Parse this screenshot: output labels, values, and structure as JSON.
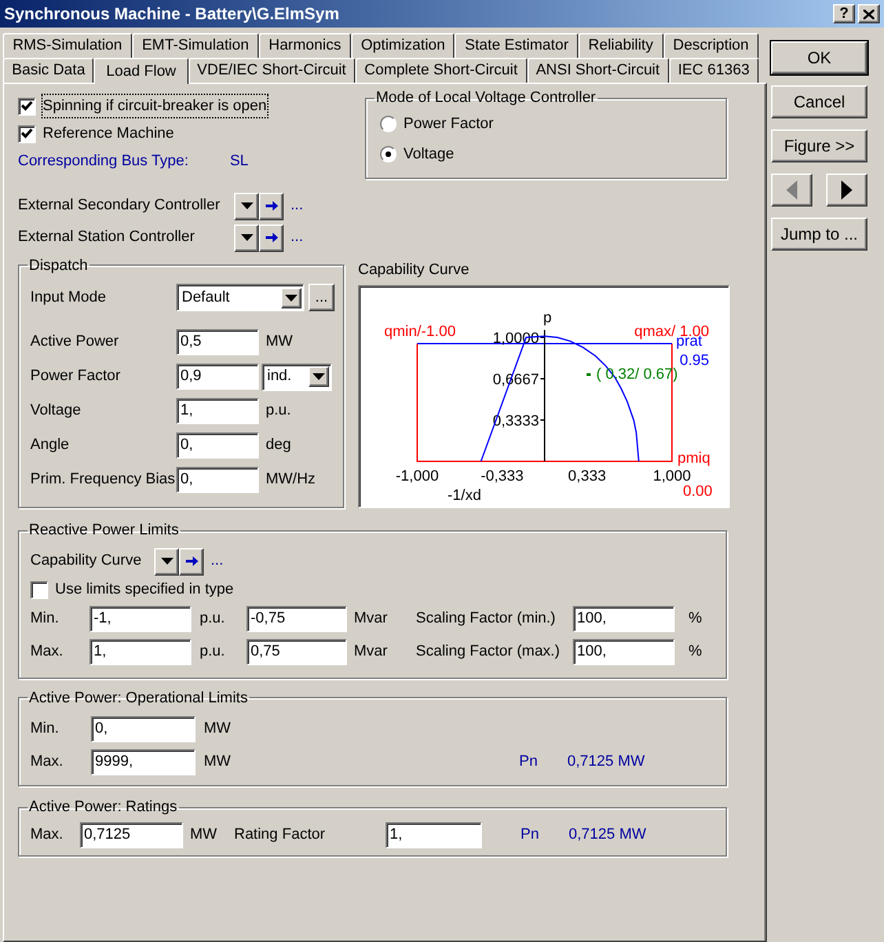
{
  "window": {
    "title": "Synchronous Machine - Battery\\G.ElmSym",
    "help": "?"
  },
  "tab_rows": [
    {
      "tabs": [
        {
          "label": "RMS-Simulation",
          "selected": false
        },
        {
          "label": "EMT-Simulation",
          "selected": false
        },
        {
          "label": "Harmonics",
          "selected": false
        },
        {
          "label": "Optimization",
          "selected": false
        },
        {
          "label": "State Estimator",
          "selected": false
        },
        {
          "label": "Reliability",
          "selected": false
        },
        {
          "label": "Description",
          "selected": false
        }
      ]
    },
    {
      "tabs": [
        {
          "label": "Basic Data",
          "selected": false
        },
        {
          "label": "Load Flow",
          "selected": true
        },
        {
          "label": "VDE/IEC Short-Circuit",
          "selected": false
        },
        {
          "label": "Complete Short-Circuit",
          "selected": false
        },
        {
          "label": "ANSI Short-Circuit",
          "selected": false
        },
        {
          "label": "IEC 61363",
          "selected": false
        }
      ]
    }
  ],
  "options": [
    {
      "label": "Spinning if circuit-breaker is open",
      "checked": true
    },
    {
      "label": "Reference Machine",
      "checked": true
    }
  ],
  "bus_type": {
    "label": "Corresponding Bus Type:",
    "value": "SL"
  },
  "voltage_mode": {
    "title": "Mode of Local Voltage Controller",
    "options": [
      {
        "label": "Power Factor",
        "selected": false
      },
      {
        "label": "Voltage",
        "selected": true
      }
    ]
  },
  "external_controllers": [
    {
      "label": "External Secondary Controller",
      "more": "..."
    },
    {
      "label": "External Station Controller",
      "more": "..."
    }
  ],
  "dispatch": {
    "title": "Dispatch",
    "input_mode": {
      "label": "Input Mode",
      "value": "Default",
      "more": "..."
    },
    "fields": [
      {
        "label": "Active Power",
        "value": "0,5",
        "kind": "unit",
        "unit": "MW"
      },
      {
        "label": "Power Factor",
        "value": "0,9",
        "kind": "select",
        "option": "ind."
      },
      {
        "label": "Voltage",
        "value": "1,",
        "kind": "unit",
        "unit": "p.u."
      },
      {
        "label": "Angle",
        "value": "0,",
        "kind": "unit",
        "unit": "deg"
      },
      {
        "label": "Prim. Frequency Bias",
        "value": "0,",
        "kind": "unit",
        "unit": "MW/Hz"
      }
    ]
  },
  "capability_curve": {
    "title": "Capability Curve",
    "chart_data": {
      "type": "line",
      "xlabel": "-1/xd",
      "ylabel": "p",
      "xlim": [
        -1,
        1
      ],
      "ylim": [
        0,
        1.06
      ],
      "xticks": [
        {
          "value": -1,
          "label": "-1,000"
        },
        {
          "value": -0.333,
          "label": "-0,333"
        },
        {
          "value": 0.333,
          "label": "0,333"
        },
        {
          "value": 1,
          "label": "1,000"
        }
      ],
      "yticks": [
        {
          "value": 0.3333,
          "label": "0,3333"
        },
        {
          "value": 0.6667,
          "label": "0,6667"
        },
        {
          "value": 1,
          "label": "1,0000"
        }
      ],
      "x": [
        -0.5,
        -0.145,
        0,
        0.1,
        0.2,
        0.3,
        0.4,
        0.48,
        0.55,
        0.6,
        0.65,
        0.7,
        0.72,
        0.74
      ],
      "series": [
        {
          "color": "#0000ff",
          "values": [
            0,
            1.0,
            1.01,
            1.0,
            0.97,
            0.92,
            0.85,
            0.77,
            0.68,
            0.59,
            0.48,
            0.33,
            0.23,
            0
          ]
        }
      ],
      "ref_lines": [
        {
          "axis": "y",
          "value": 0.95,
          "color": "#0000ff"
        }
      ],
      "annotations": [
        "qmin/-1.00",
        "qmax/ 1.00",
        "prat",
        "0.95",
        "pmiq",
        "0.00",
        "( 0.32/ 0.67)"
      ]
    }
  },
  "reactive_limits": {
    "title": "Reactive Power Limits",
    "curve": {
      "label": "Capability Curve",
      "more": "..."
    },
    "use_type": {
      "label": "Use limits specified in type",
      "checked": false
    },
    "rows": [
      {
        "label": "Min.",
        "pu_value": "-1,",
        "pu_unit": "p.u.",
        "mvar_value": "-0,75",
        "mvar_unit": "Mvar",
        "factor_label": "Scaling Factor (min.)",
        "factor_value": "100,",
        "factor_unit": "%"
      },
      {
        "label": "Max.",
        "pu_value": "1,",
        "pu_unit": "p.u.",
        "mvar_value": "0,75",
        "mvar_unit": "Mvar",
        "factor_label": "Scaling Factor (max.)",
        "factor_value": "100,",
        "factor_unit": "%"
      }
    ]
  },
  "operational_limits": {
    "title": "Active Power: Operational Limits",
    "rows": [
      {
        "label": "Min.",
        "value": "0,",
        "unit": "MW"
      },
      {
        "label": "Max.",
        "value": "9999,",
        "unit": "MW",
        "nominal_label": "Pn",
        "nominal_value": "0,7125 MW"
      }
    ]
  },
  "ratings": {
    "title": "Active Power: Ratings",
    "label": "Max.",
    "value": "0,7125",
    "unit": "MW",
    "factor_label": "Rating Factor",
    "factor_value": "1,",
    "nominal_label": "Pn",
    "nominal_value": "0,7125 MW"
  },
  "side_buttons": [
    {
      "kind": "text",
      "label": "OK",
      "default": true
    },
    {
      "kind": "text",
      "label": "Cancel",
      "default": false
    },
    {
      "kind": "text",
      "label": "Figure >>",
      "default": false
    },
    {
      "kind": "nav",
      "items": [
        {
          "disabled": true
        },
        {
          "disabled": false
        }
      ]
    },
    {
      "kind": "text",
      "label": "Jump to ...",
      "default": false
    }
  ]
}
